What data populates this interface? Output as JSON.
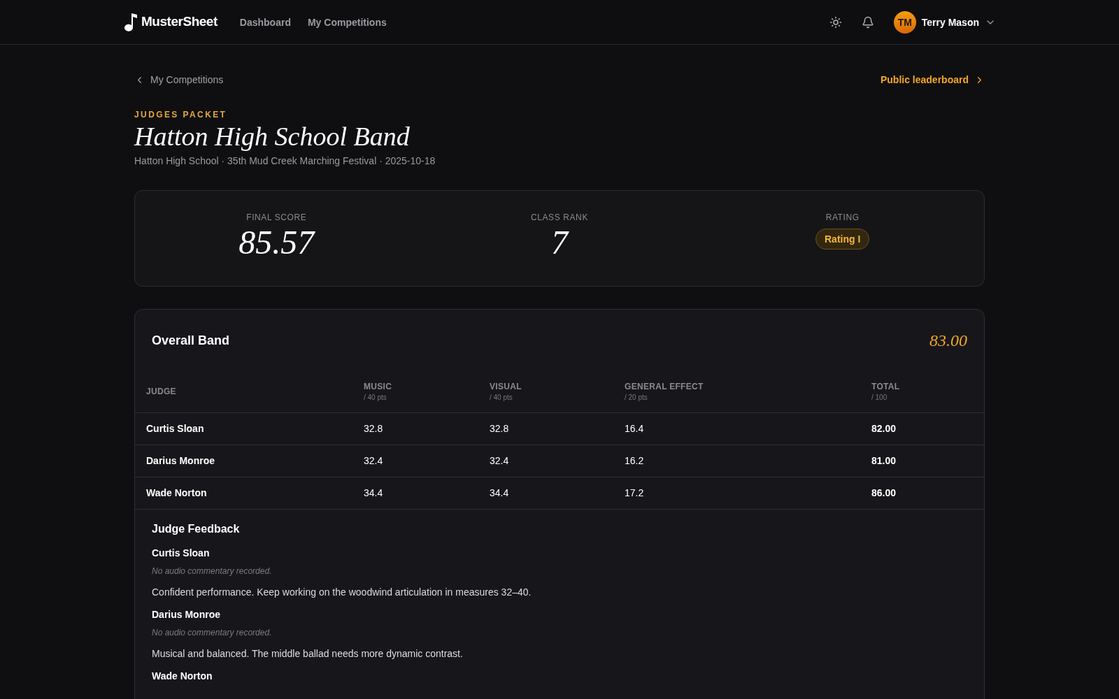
{
  "nav": {
    "logo": "MusterSheet",
    "links": [
      {
        "label": "Dashboard",
        "selected": false
      },
      {
        "label": "My Competitions",
        "selected": false
      }
    ],
    "user": {
      "initials": "TM",
      "name": "Terry Mason"
    }
  },
  "back_link": "My Competitions",
  "leaderboard_link": "Public leaderboard",
  "eyebrow": "JUDGES PACKET",
  "title": "Hatton High School Band",
  "subtitle": "Hatton High School · 35th Mud Creek Marching Festival · 2025-10-18",
  "summary": [
    {
      "kind": "score",
      "label": "FINAL SCORE",
      "value": "85.57"
    },
    {
      "kind": "score",
      "label": "CLASS RANK",
      "value": "7"
    },
    {
      "kind": "badge",
      "label": "RATING",
      "value": "Rating I"
    }
  ],
  "section": {
    "title": "Overall Band",
    "score": "83.00",
    "columns": [
      {
        "label": "JUDGE"
      },
      {
        "label": "MUSIC",
        "sub": "/ 40 pts"
      },
      {
        "label": "VISUAL",
        "sub": "/ 40 pts"
      },
      {
        "label": "GENERAL EFFECT",
        "sub": "/ 20 pts"
      },
      {
        "label": "TOTAL",
        "sub": "/ 100"
      }
    ],
    "rows": [
      [
        "Curtis Sloan",
        "32.8",
        "32.8",
        "16.4",
        "82.00"
      ],
      [
        "Darius Monroe",
        "32.4",
        "32.4",
        "16.2",
        "81.00"
      ],
      [
        "Wade Norton",
        "34.4",
        "34.4",
        "17.2",
        "86.00"
      ]
    ],
    "feedback_title": "Judge Feedback",
    "feedback": [
      {
        "judge": "Curtis Sloan",
        "audio": "No audio commentary recorded.",
        "comment": "Confident performance. Keep working on the woodwind articulation in measures 32–40."
      },
      {
        "judge": "Darius Monroe",
        "audio": "No audio commentary recorded.",
        "comment": "Musical and balanced. The middle ballad needs more dynamic contrast."
      },
      {
        "judge": "Wade Norton"
      }
    ]
  }
}
